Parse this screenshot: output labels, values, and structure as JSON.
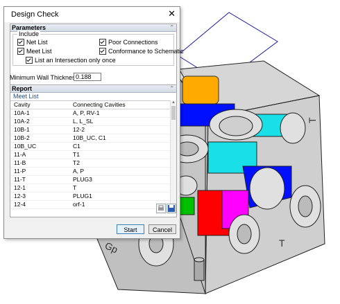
{
  "dialog": {
    "title": "Design Check",
    "parameters_header": "Parameters",
    "include_label": "Include",
    "checks": {
      "net_list": "Net List",
      "poor_connections": "Poor Connections",
      "meet_list": "Meet List",
      "conformance": "Conformance to Schematic",
      "list_intersection": "List an Intersection only once"
    },
    "min_wall_label": "Minimum Wall Thickness",
    "min_wall_value": "0.188",
    "report_header": "Report",
    "meet_list_title": "Meet List",
    "columns": [
      "Cavity",
      "Connecting Cavities"
    ],
    "rows": [
      [
        "10A-1",
        "A, P, RV-1"
      ],
      [
        "10A-2",
        "L, L_SL"
      ],
      [
        "10B-1",
        "12-2"
      ],
      [
        "10B-2",
        "10B_UC, C1"
      ],
      [
        "10B_UC",
        "C1"
      ],
      [
        "11-A",
        "T1"
      ],
      [
        "11-B",
        "T2"
      ],
      [
        "11-P",
        "A, P"
      ],
      [
        "11-T",
        "PLUG3"
      ],
      [
        "12-1",
        "T"
      ],
      [
        "12-3",
        "PLUG1"
      ],
      [
        "12-4",
        "orf-1"
      ]
    ],
    "start_label": "Start",
    "cancel_label": "Cancel"
  },
  "model_labels": {
    "gp": "Gp",
    "t": "T",
    "t_rot": "T"
  },
  "colors": {
    "block": "#c4c4c4",
    "cyan": "#19e0e6",
    "blue": "#0010ff",
    "red": "#ff0000",
    "magenta": "#ff00ff",
    "green": "#00c000",
    "orange": "#ffaa00",
    "dark_gray": "#666666"
  }
}
